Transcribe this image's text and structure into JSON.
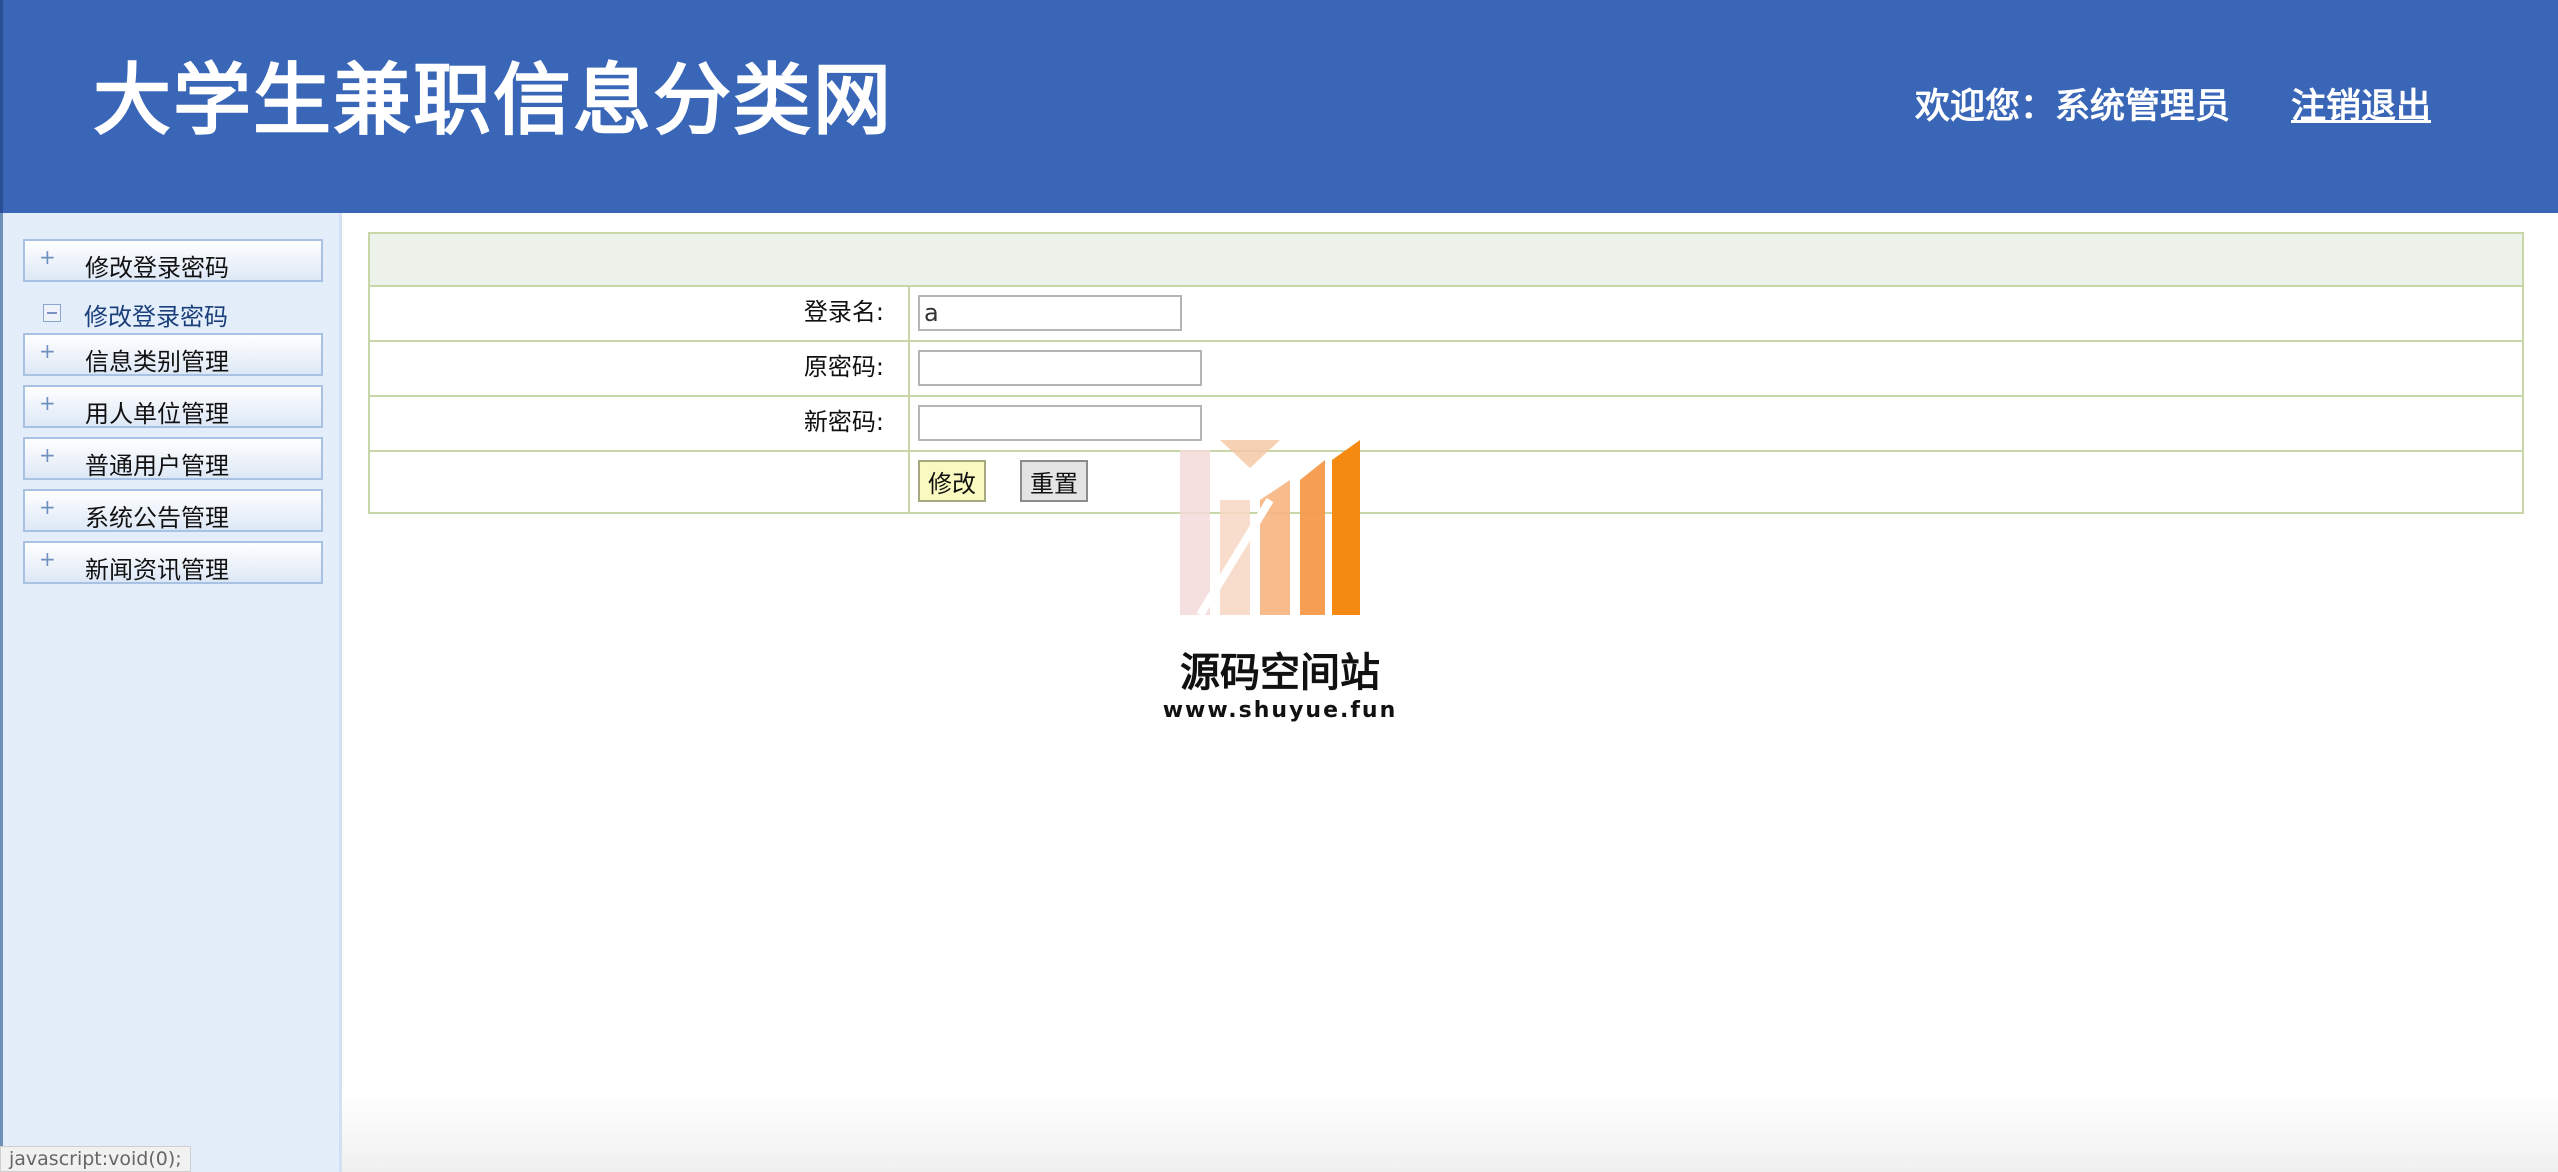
{
  "header": {
    "site_title": "大学生兼职信息分类网",
    "welcome_text": "欢迎您：系统管理员",
    "logout_label": "注销退出"
  },
  "sidebar": {
    "menus": [
      {
        "label": "修改登录密码",
        "expanded": true,
        "submenu": [
          {
            "label": "修改登录密码"
          }
        ]
      },
      {
        "label": "信息类别管理"
      },
      {
        "label": "用人单位管理"
      },
      {
        "label": "普通用户管理"
      },
      {
        "label": "系统公告管理"
      },
      {
        "label": "新闻资讯管理"
      }
    ]
  },
  "form": {
    "login_name_label": "登录名:",
    "login_name_value": "a",
    "old_password_label": "原密码:",
    "new_password_label": "新密码:",
    "submit_label": "修改",
    "reset_label": "重置"
  },
  "watermark": {
    "name": "源码空间站",
    "url": "www.shuyue.fun"
  },
  "statusbar": {
    "text": "javascript:void(0);"
  },
  "colors": {
    "header_bg": "#3a66b8",
    "sidebar_bg": "#e4eefa",
    "table_border": "#c8d7a8",
    "table_head_bg": "#edf3ea",
    "submit_bg": "#fafac0"
  }
}
